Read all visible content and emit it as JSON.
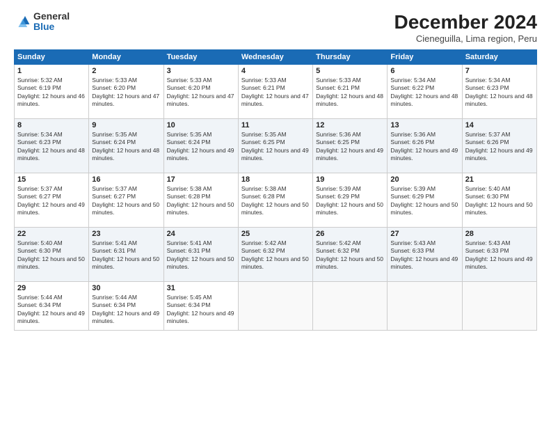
{
  "header": {
    "logo_general": "General",
    "logo_blue": "Blue",
    "month_title": "December 2024",
    "location": "Cieneguilla, Lima region, Peru"
  },
  "days_of_week": [
    "Sunday",
    "Monday",
    "Tuesday",
    "Wednesday",
    "Thursday",
    "Friday",
    "Saturday"
  ],
  "weeks": [
    [
      {
        "num": "1",
        "sunrise": "5:32 AM",
        "sunset": "6:19 PM",
        "daylight": "12 hours and 46 minutes."
      },
      {
        "num": "2",
        "sunrise": "5:33 AM",
        "sunset": "6:20 PM",
        "daylight": "12 hours and 47 minutes."
      },
      {
        "num": "3",
        "sunrise": "5:33 AM",
        "sunset": "6:20 PM",
        "daylight": "12 hours and 47 minutes."
      },
      {
        "num": "4",
        "sunrise": "5:33 AM",
        "sunset": "6:21 PM",
        "daylight": "12 hours and 47 minutes."
      },
      {
        "num": "5",
        "sunrise": "5:33 AM",
        "sunset": "6:21 PM",
        "daylight": "12 hours and 48 minutes."
      },
      {
        "num": "6",
        "sunrise": "5:34 AM",
        "sunset": "6:22 PM",
        "daylight": "12 hours and 48 minutes."
      },
      {
        "num": "7",
        "sunrise": "5:34 AM",
        "sunset": "6:23 PM",
        "daylight": "12 hours and 48 minutes."
      }
    ],
    [
      {
        "num": "8",
        "sunrise": "5:34 AM",
        "sunset": "6:23 PM",
        "daylight": "12 hours and 48 minutes."
      },
      {
        "num": "9",
        "sunrise": "5:35 AM",
        "sunset": "6:24 PM",
        "daylight": "12 hours and 48 minutes."
      },
      {
        "num": "10",
        "sunrise": "5:35 AM",
        "sunset": "6:24 PM",
        "daylight": "12 hours and 49 minutes."
      },
      {
        "num": "11",
        "sunrise": "5:35 AM",
        "sunset": "6:25 PM",
        "daylight": "12 hours and 49 minutes."
      },
      {
        "num": "12",
        "sunrise": "5:36 AM",
        "sunset": "6:25 PM",
        "daylight": "12 hours and 49 minutes."
      },
      {
        "num": "13",
        "sunrise": "5:36 AM",
        "sunset": "6:26 PM",
        "daylight": "12 hours and 49 minutes."
      },
      {
        "num": "14",
        "sunrise": "5:37 AM",
        "sunset": "6:26 PM",
        "daylight": "12 hours and 49 minutes."
      }
    ],
    [
      {
        "num": "15",
        "sunrise": "5:37 AM",
        "sunset": "6:27 PM",
        "daylight": "12 hours and 49 minutes."
      },
      {
        "num": "16",
        "sunrise": "5:37 AM",
        "sunset": "6:27 PM",
        "daylight": "12 hours and 50 minutes."
      },
      {
        "num": "17",
        "sunrise": "5:38 AM",
        "sunset": "6:28 PM",
        "daylight": "12 hours and 50 minutes."
      },
      {
        "num": "18",
        "sunrise": "5:38 AM",
        "sunset": "6:28 PM",
        "daylight": "12 hours and 50 minutes."
      },
      {
        "num": "19",
        "sunrise": "5:39 AM",
        "sunset": "6:29 PM",
        "daylight": "12 hours and 50 minutes."
      },
      {
        "num": "20",
        "sunrise": "5:39 AM",
        "sunset": "6:29 PM",
        "daylight": "12 hours and 50 minutes."
      },
      {
        "num": "21",
        "sunrise": "5:40 AM",
        "sunset": "6:30 PM",
        "daylight": "12 hours and 50 minutes."
      }
    ],
    [
      {
        "num": "22",
        "sunrise": "5:40 AM",
        "sunset": "6:30 PM",
        "daylight": "12 hours and 50 minutes."
      },
      {
        "num": "23",
        "sunrise": "5:41 AM",
        "sunset": "6:31 PM",
        "daylight": "12 hours and 50 minutes."
      },
      {
        "num": "24",
        "sunrise": "5:41 AM",
        "sunset": "6:31 PM",
        "daylight": "12 hours and 50 minutes."
      },
      {
        "num": "25",
        "sunrise": "5:42 AM",
        "sunset": "6:32 PM",
        "daylight": "12 hours and 50 minutes."
      },
      {
        "num": "26",
        "sunrise": "5:42 AM",
        "sunset": "6:32 PM",
        "daylight": "12 hours and 50 minutes."
      },
      {
        "num": "27",
        "sunrise": "5:43 AM",
        "sunset": "6:33 PM",
        "daylight": "12 hours and 49 minutes."
      },
      {
        "num": "28",
        "sunrise": "5:43 AM",
        "sunset": "6:33 PM",
        "daylight": "12 hours and 49 minutes."
      }
    ],
    [
      {
        "num": "29",
        "sunrise": "5:44 AM",
        "sunset": "6:34 PM",
        "daylight": "12 hours and 49 minutes."
      },
      {
        "num": "30",
        "sunrise": "5:44 AM",
        "sunset": "6:34 PM",
        "daylight": "12 hours and 49 minutes."
      },
      {
        "num": "31",
        "sunrise": "5:45 AM",
        "sunset": "6:34 PM",
        "daylight": "12 hours and 49 minutes."
      },
      null,
      null,
      null,
      null
    ]
  ]
}
